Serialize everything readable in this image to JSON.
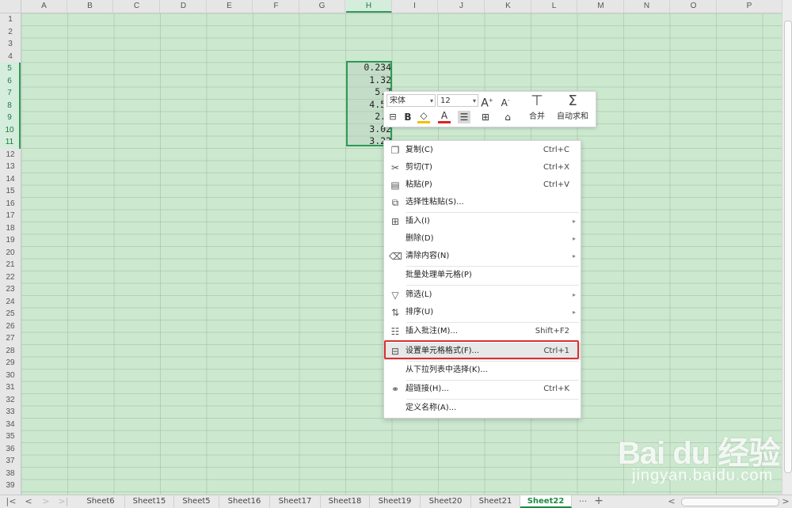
{
  "columns": [
    "A",
    "B",
    "C",
    "D",
    "E",
    "F",
    "G",
    "H",
    "I",
    "J",
    "K",
    "L",
    "M",
    "N",
    "O",
    "P"
  ],
  "active_column": "H",
  "rows": [
    "1",
    "2",
    "3",
    "4",
    "5",
    "6",
    "7",
    "8",
    "9",
    "10",
    "11",
    "12",
    "13",
    "14",
    "15",
    "16",
    "17",
    "18",
    "19",
    "20",
    "21",
    "22",
    "23",
    "24",
    "25",
    "26",
    "27",
    "28",
    "29",
    "30",
    "31",
    "32",
    "33",
    "34",
    "35",
    "36",
    "37",
    "38",
    "39"
  ],
  "active_rows": [
    "5",
    "6",
    "7",
    "8",
    "9",
    "10",
    "11"
  ],
  "cells": [
    "0.234",
    "1.32",
    "5.7",
    "4.56",
    "2.0",
    "3.02",
    "3.22"
  ],
  "mini_toolbar": {
    "font": "宋体",
    "size": "12",
    "merge_label": "合并",
    "autosum_label": "自动求和"
  },
  "context_menu": [
    {
      "icon": "copy-icon",
      "label": "复制(C)",
      "shortcut": "Ctrl+C"
    },
    {
      "icon": "scissors-icon",
      "label": "剪切(T)",
      "shortcut": "Ctrl+X"
    },
    {
      "icon": "paste-icon",
      "label": "粘贴(P)",
      "shortcut": "Ctrl+V"
    },
    {
      "icon": "paste-special-icon",
      "label": "选择性粘贴(S)...",
      "shortcut": ""
    },
    {
      "icon": "insert-icon",
      "label": "插入(I)",
      "shortcut": ""
    },
    {
      "icon": "",
      "label": "删除(D)",
      "shortcut": ""
    },
    {
      "icon": "eraser-icon",
      "label": "清除内容(N)",
      "shortcut": ""
    },
    {
      "icon": "",
      "label": "批量处理单元格(P)",
      "shortcut": ""
    },
    {
      "icon": "filter-icon",
      "label": "筛选(L)",
      "shortcut": ""
    },
    {
      "icon": "sort-icon",
      "label": "排序(U)",
      "shortcut": ""
    },
    {
      "icon": "comment-icon",
      "label": "插入批注(M)...",
      "shortcut": "Shift+F2"
    },
    {
      "icon": "format-cells-icon",
      "label": "设置单元格格式(F)...",
      "shortcut": "Ctrl+1"
    },
    {
      "icon": "",
      "label": "从下拉列表中选择(K)...",
      "shortcut": ""
    },
    {
      "icon": "link-icon",
      "label": "超链接(H)...",
      "shortcut": "Ctrl+K"
    },
    {
      "icon": "",
      "label": "定义名称(A)...",
      "shortcut": ""
    }
  ],
  "sheet_tabs": [
    "Sheet6",
    "Sheet15",
    "Sheet5",
    "Sheet16",
    "Sheet17",
    "Sheet18",
    "Sheet19",
    "Sheet20",
    "Sheet21",
    "Sheet22"
  ],
  "active_tab": "Sheet22",
  "tab_more": "···",
  "tab_add": "+",
  "watermark": {
    "logo": "Bai du 经验",
    "url": "jingyan.baidu.com"
  }
}
